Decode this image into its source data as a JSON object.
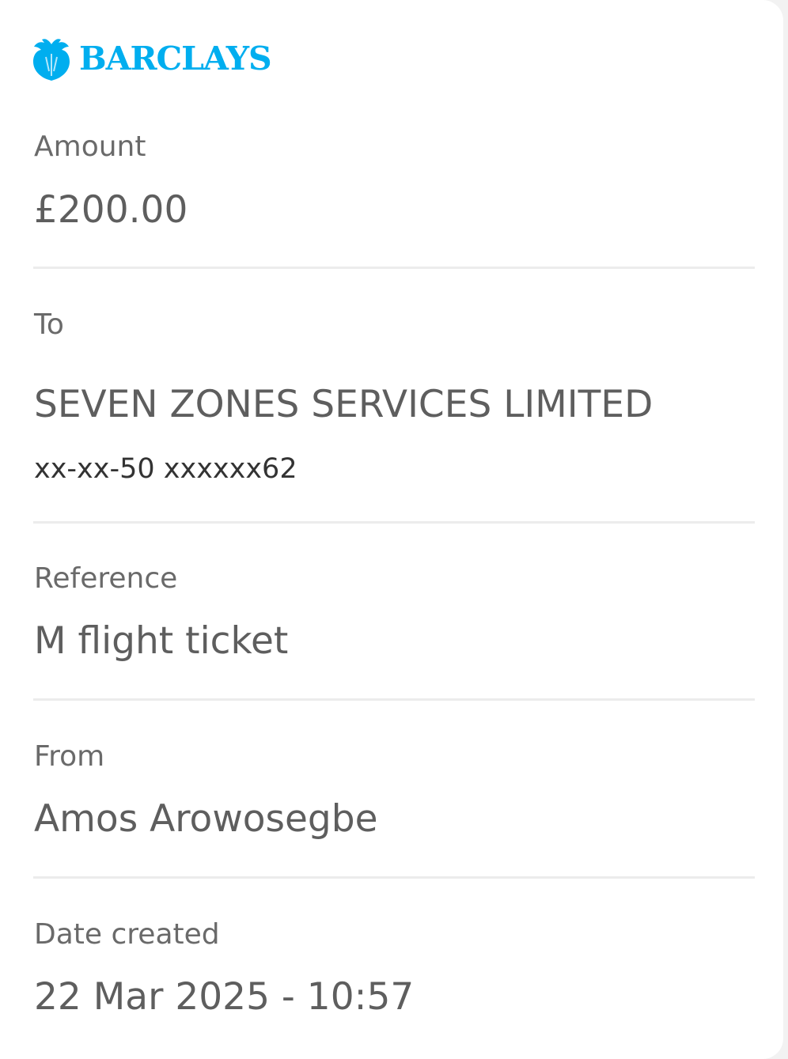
{
  "brand": {
    "name": "BARCLAYS",
    "logo_icon": "eagle-icon",
    "color": "#00aeef"
  },
  "fields": {
    "amount": {
      "label": "Amount",
      "value": "£200.00"
    },
    "to": {
      "label": "To",
      "value": "SEVEN ZONES SERVICES LIMITED",
      "account": "xx-xx-50 xxxxxx62"
    },
    "reference": {
      "label": "Reference",
      "value": "M flight ticket"
    },
    "from": {
      "label": "From",
      "value": "Amos Arowosegbe"
    },
    "date_created": {
      "label": "Date created",
      "value": "22 Mar 2025 - 10:57"
    }
  }
}
